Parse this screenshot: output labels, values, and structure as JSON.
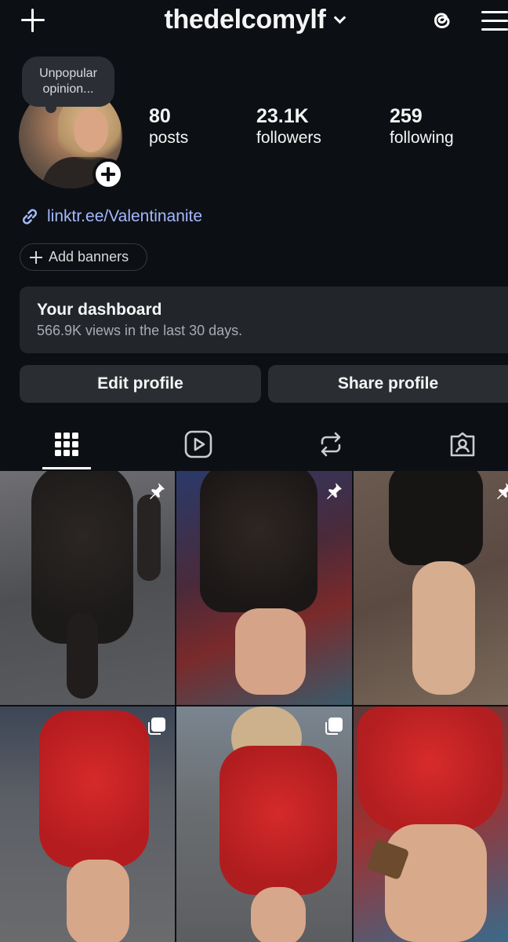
{
  "header": {
    "username": "thedelcomylf",
    "icons": [
      "plus-icon",
      "chevron-down-icon",
      "threads-icon",
      "menu-icon"
    ]
  },
  "note": {
    "text": "Unpopular opinion..."
  },
  "stats": {
    "posts": {
      "value": "80",
      "label": "posts"
    },
    "followers": {
      "value": "23.1K",
      "label": "followers"
    },
    "following": {
      "value": "259",
      "label": "following"
    }
  },
  "bio": {
    "link": "linktr.ee/Valentinanite"
  },
  "banners": {
    "label": "Add banners"
  },
  "dashboard": {
    "title": "Your dashboard",
    "subtitle": "566.9K views in the last 30 days."
  },
  "actions": {
    "edit": "Edit profile",
    "share": "Share profile"
  },
  "tabs": [
    "grid-icon",
    "reels-icon",
    "reposts-icon",
    "tagged-icon"
  ],
  "grid": {
    "posts": [
      {
        "kind": "photo",
        "badge": "pin-icon"
      },
      {
        "kind": "photo",
        "badge": "pin-icon"
      },
      {
        "kind": "photo",
        "badge": "pin-icon"
      },
      {
        "kind": "photo",
        "badge": "carousel-icon"
      },
      {
        "kind": "photo",
        "badge": "carousel-icon"
      },
      {
        "kind": "photo",
        "badge": "none"
      }
    ]
  },
  "colors": {
    "background": "#0c1014",
    "link": "#a5b8ff",
    "button": "#2a2e33"
  }
}
